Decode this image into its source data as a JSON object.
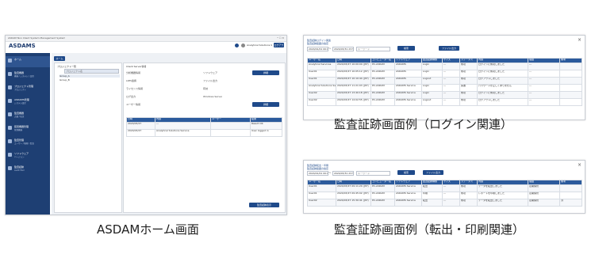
{
  "captions": {
    "home": "ASDAMホーム画面",
    "login": "監査証跡画面例（ログイン関連）",
    "print": "監査証跡画面例（転出・印刷関連）"
  },
  "home": {
    "window_title": "ASDAM Non Client System Management System",
    "app_name": "ASDAMS",
    "user_text": "Analytical Solutions Services",
    "logout_label": "ログアウト",
    "tab_home": "ホーム",
    "sidebar": [
      {
        "label": "ホーム",
        "sub": ""
      },
      {
        "label": "監査機器",
        "sub": "機器 / システム / 品目"
      },
      {
        "label": "プロジェクト管理",
        "sub": "プロジェクト"
      },
      {
        "label": "ASDAMS管理",
        "sub": "システム設定"
      },
      {
        "label": "監査機器",
        "sub": "点検 / 校正"
      },
      {
        "label": "装置機器管理",
        "sub": "管理機器"
      },
      {
        "label": "監査管理",
        "sub": "ユーザー / 権限 / 監査"
      },
      {
        "label": "ソフトウェア",
        "sub": "バージョン"
      },
      {
        "label": "監査証跡",
        "sub": "Audit Trail"
      }
    ],
    "tree": {
      "header": "プロジェクト一覧",
      "search": "プロジェクト名",
      "items": [
        "Group_A",
        "Group_B"
      ]
    },
    "info": {
      "title": "Client Server情報",
      "rows": [
        {
          "label": "分析機器情報",
          "value": "ソフトウェア",
          "button": "詳細"
        },
        {
          "label": "LIMS連携",
          "value": "ファイル出力",
          "button": ""
        },
        {
          "label": "ライセンス情報",
          "value": "有効",
          "button": ""
        },
        {
          "label": "ログ出力",
          "value": "Windows Server",
          "button": ""
        },
        {
          "label": "ユーザー情報",
          "value": "",
          "button": "詳細"
        }
      ]
    },
    "table": {
      "headers": [
        "日時",
        "内容",
        "ユーザー",
        "結果"
      ],
      "rows": [
        [
          "2024/03/27",
          "---",
          "",
          "Result OK"
        ],
        [
          "2024/03/27",
          "Analytical Solutions Service",
          "",
          "User logged in"
        ]
      ]
    },
    "bottom_button": "監査証跡表示"
  },
  "login_screen": {
    "title": "監査証跡ログイン関連",
    "subtitle": "監査証跡範囲の指定",
    "date_from": "2024/01/01 00:00",
    "date_to": "2024/03/31 23:59",
    "keyword": "キーワード",
    "search_btn": "検索",
    "export_btn": "ファイル出力",
    "headers": [
      "ユーザー名",
      "日時",
      "コンピューター名",
      "ソフトウェア",
      "監査証跡種類",
      "サイズ",
      "ステータス",
      "内容",
      "理由",
      "備考"
    ],
    "rows": [
      [
        "Analytical Services",
        "2024/03/27 10:00:00 (JST)",
        "PC-ASDAM",
        "ASDAMS",
        "Login",
        "---",
        "成功",
        "ログインに成功しました",
        "---",
        ""
      ],
      [
        "User01",
        "2024/03/27 10:05:12 (JST)",
        "PC-ASDAM",
        "ASDAMS",
        "Login",
        "---",
        "成功",
        "ログインに成功しました",
        "---",
        ""
      ],
      [
        "User01",
        "2024/03/27 10:10:44 (JST)",
        "PC-ASDAM",
        "ASDAMS",
        "Logout",
        "---",
        "成功",
        "ログアウトしました",
        "---",
        ""
      ],
      [
        "Analytical Solutions Service",
        "2024/03/27 11:21:03 (JST)",
        "PC-ASDAM",
        "ASDAMS Service",
        "Login",
        "---",
        "失敗",
        "パスワードが正しくありません",
        "---",
        ""
      ],
      [
        "User02",
        "2024/03/27 13:40:18 (JST)",
        "PC-ASDAM",
        "ASDAMS Service",
        "Login",
        "---",
        "成功",
        "ログインに成功しました",
        "---",
        ""
      ],
      [
        "User02",
        "2024/03/27 14:02:55 (JST)",
        "PC-ASDAM",
        "ASDAMS Service",
        "Logout",
        "---",
        "成功",
        "ログアウトしました",
        "---",
        ""
      ]
    ]
  },
  "print_screen": {
    "title": "監査証跡転出・印刷",
    "subtitle": "監査証跡範囲の指定",
    "date_from": "2024/01/01 00:00",
    "date_to": "2024/03/31 23:59",
    "keyword": "キーワード",
    "search_btn": "検索",
    "export_btn": "ファイル出力",
    "headers": [
      "ユーザー名",
      "日時",
      "コンピューター名",
      "ソフトウェア",
      "監査証跡種類",
      "サイズ",
      "ステータス",
      "内容",
      "理由",
      "備考"
    ],
    "rows": [
      [
        "User01",
        "2024/03/27 09:11:20 (JST)",
        "PC-ASDAM",
        "ASDAMS Service",
        "転出",
        "---",
        "成功",
        "データを転出しました",
        "定期保管",
        ""
      ],
      [
        "User01",
        "2024/03/27 09:45:02 (JST)",
        "PC-ASDAM",
        "ASDAMS Service",
        "印刷",
        "---",
        "成功",
        "レポートを印刷しました",
        "定期保管",
        ""
      ],
      [
        "User02",
        "2024/03/27 15:30:41 (JST)",
        "PC-ASDAM",
        "ASDAMS Service",
        "転出",
        "---",
        "成功",
        "データを転出しました",
        "定期保管",
        "済"
      ]
    ]
  }
}
